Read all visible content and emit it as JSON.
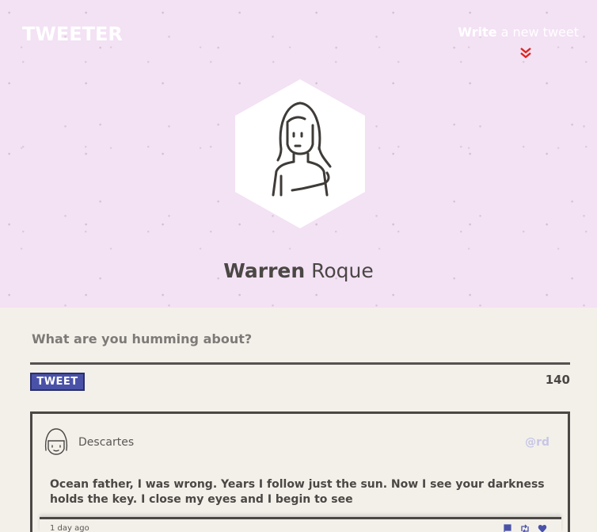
{
  "app": {
    "logo": "TWEETER"
  },
  "nav": {
    "write_bold": "Write",
    "write_rest": " a new tweet",
    "toggle_icon": "double-chevron-down-icon",
    "toggle_color": "#e0231c"
  },
  "profile": {
    "avatar_icon": "user-avatar-icon",
    "first_name": "Warren",
    "last_name": " Roque"
  },
  "compose": {
    "placeholder": "What are you humming about?",
    "tweet_label": "TWEET",
    "char_count": "140"
  },
  "tweets": [
    {
      "avatar_icon": "user-avatar-icon",
      "author": "Descartes",
      "handle": "@rd",
      "text": "Ocean father, I was wrong. Years I follow just the sun. Now I see your darkness holds the key. I close my eyes and I begin to see",
      "time": "1 day ago",
      "actions": [
        "flag-icon",
        "retweet-icon",
        "heart-icon"
      ]
    }
  ],
  "colors": {
    "header_bg": "#f3e1f4",
    "page_bg": "#f3f0ea",
    "accent": "#4a52a8",
    "handle": "#c7c6e6"
  }
}
